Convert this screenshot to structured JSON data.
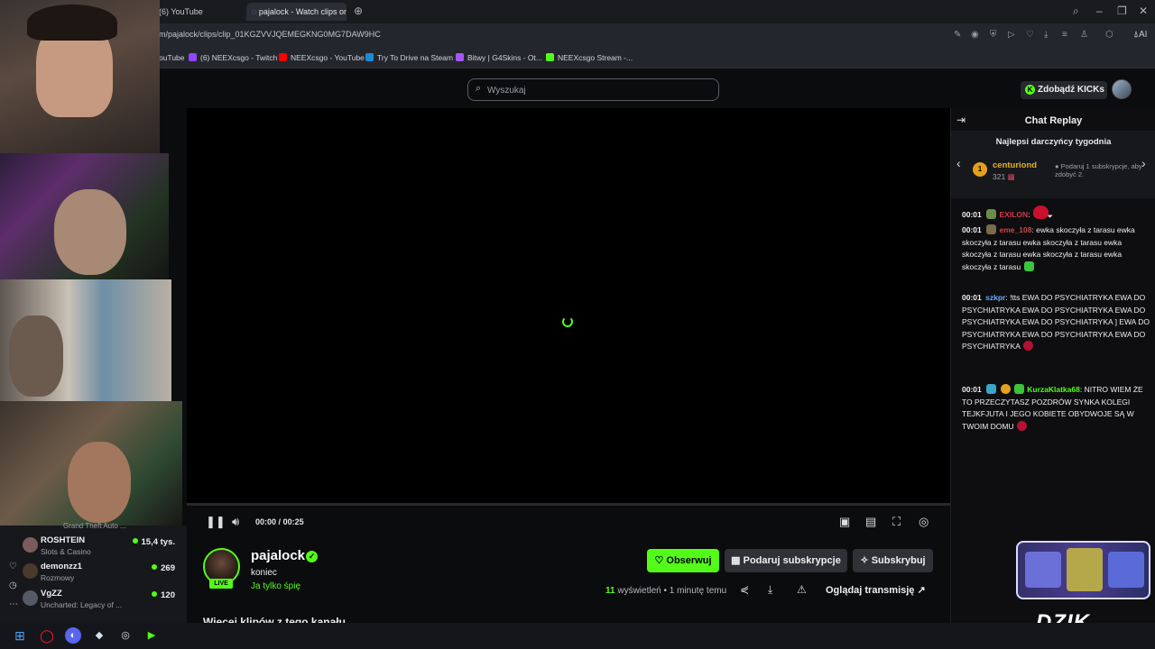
{
  "browser": {
    "tabs": [
      {
        "label": "(6) YouTube"
      },
      {
        "label": "pajalock - Watch clips on"
      }
    ],
    "url": "m/pajalock/clips/clip_01KGZVVJQEMEGKNG0MG7DAW9HC",
    "ai_label": "AI",
    "bookmarks": [
      {
        "label": "ouTube",
        "color": "#ff0000"
      },
      {
        "label": "(6) NEEXcsgo - Twitch",
        "color": "#9146ff"
      },
      {
        "label": "NEEXcsgo - YouTube",
        "color": "#ff0000"
      },
      {
        "label": "Try To Drive na Steam",
        "color": "#1b8ad6"
      },
      {
        "label": "Bitwy | G4Skins - Ot...",
        "color": "#a855f7"
      },
      {
        "label": "NEEXcsgo Stream -...",
        "color": "#53fc18"
      }
    ]
  },
  "header": {
    "search_placeholder": "Wyszukaj",
    "kicks_button": "Zdobądź KICKs"
  },
  "player": {
    "time_current": "00:00",
    "time_separator": "/",
    "time_total": "00:25",
    "progress_fraction": 0
  },
  "channel": {
    "name": "pajalock",
    "live_label": "LIVE",
    "clip_title": "koniec",
    "category": "Ja tylko śpię",
    "follow_label": "Obserwuj",
    "gift_label": "Podaruj subskrypcje",
    "subscribe_label": "Subskrybuj",
    "views_count": "11",
    "views_label": "wyświetleń",
    "time_ago": "• 1 minutę temu",
    "watch_stream_label": "Oglądaj transmisję",
    "more_heading": "Więcej klipów z tego kanału"
  },
  "chat": {
    "title": "Chat Replay",
    "donors_heading": "Najlepsi darczyńcy tygodnia",
    "top_donor": {
      "rank": "1",
      "name": "centuriond",
      "count": "321"
    },
    "donor_hint": "Podaruj 1 subskrypcje, aby zdobyć 2.",
    "messages": [
      {
        "time": "00:01",
        "user": "EXILON",
        "user_color": "#d6374b",
        "text": ":"
      },
      {
        "time": "00:01",
        "user": "eme_108",
        "user_color": "#c44a4a",
        "text": ": ewka skoczyła z tarasu ewka skoczyła z tarasu ewka skoczyła z tarasu ewka skoczyła z tarasu ewka skoczyła z tarasu ewka skoczyła z tarasu"
      },
      {
        "time": "00:01",
        "user": "szkpr",
        "user_color": "#6fa8ff",
        "text": ": !tts EWA DO PSYCHIATRYKA EWA DO PSYCHIATRYKA EWA DO PSYCHIATRYKA EWA DO PSYCHIATRYKA EWA DO PSYCHIATRYKA ] EWA DO PSYCHIATRYKA EWA DO PSYCHIATRYKA EWA DO PSYCHIATRYKA"
      },
      {
        "time": "00:01",
        "user": "KurzaKlatka68",
        "user_color": "#53fc18",
        "text": ": NITRO WIEM ŻE TO PRZECZYTASZ POZDRÓW SYNKA KOLEGI TEJKFJUTA I JEGO KOBIETE OBYDWOJE SĄ W TWOIM DOMU"
      }
    ]
  },
  "sidebar": {
    "partial_category": "Grand Theft Auto ...",
    "items": [
      {
        "name": "ROSHTEIN",
        "category": "Slots & Casino",
        "viewers": "15,4 tys."
      },
      {
        "name": "demonzz1",
        "category": "Rozmowy",
        "viewers": "269"
      },
      {
        "name": "VgZZ",
        "category": "Uncharted: Legacy of ...",
        "viewers": "120"
      }
    ]
  },
  "overlay": {
    "promo_logo": "DZIK"
  },
  "colors": {
    "accent": "#53fc18",
    "background": "#0b0c0e"
  }
}
